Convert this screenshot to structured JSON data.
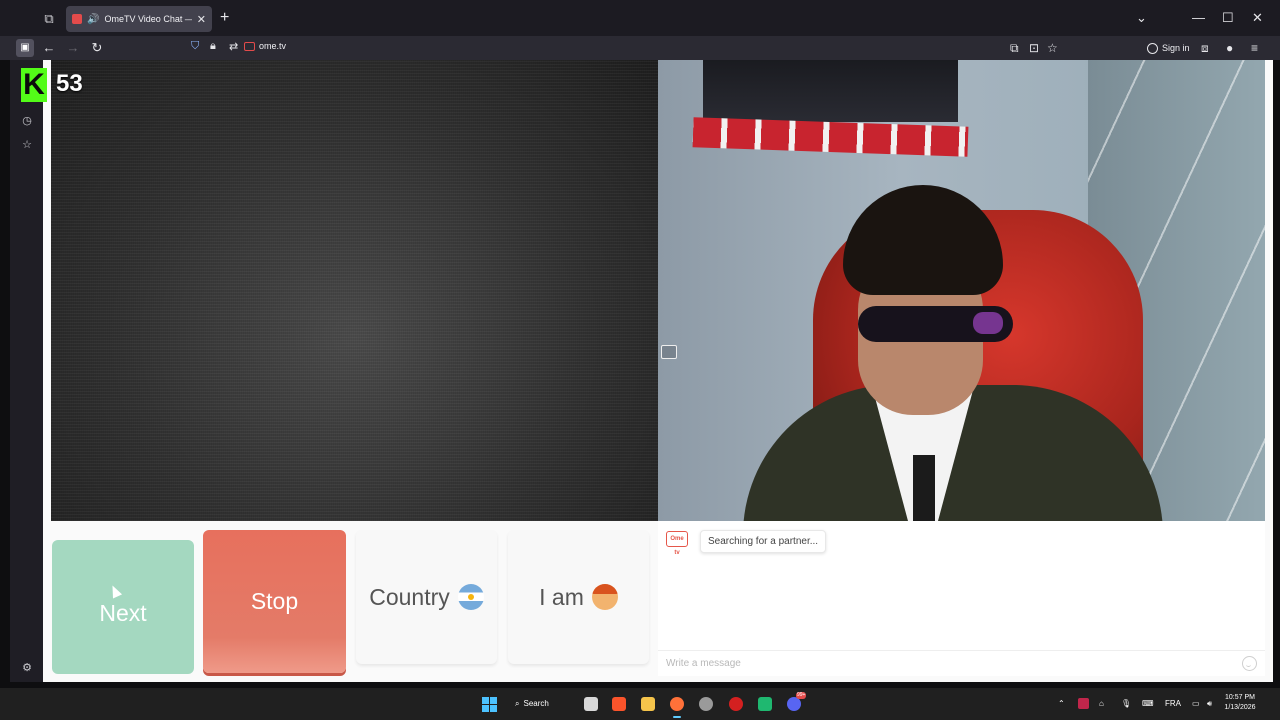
{
  "browser": {
    "tab_title": "OmeTV Video Chat — Ome",
    "tab_close": "✕",
    "new_tab": "+",
    "window_controls": {
      "list_all_tabs": "⌄",
      "minimize": "—",
      "maximize": "☐",
      "close": "✕"
    },
    "url": "ome.tv",
    "sign_in_label": "Sign in"
  },
  "stream_overlay": {
    "viewer_count": "53"
  },
  "controls": {
    "next_label": "Next",
    "stop_label": "Stop",
    "country_label": "Country",
    "country_flag": "argentina-flag-icon",
    "iam_label": "I am",
    "iam_icon": "boy-avatar-icon"
  },
  "chat": {
    "logo_text": "Ome tv",
    "status_message": "Searching for a partner...",
    "input_placeholder": "Write a message"
  },
  "taskbar": {
    "search_label": "Search",
    "language": "FRA",
    "time": "10:57 PM",
    "date": "1/13/2026",
    "discord_badge": "99+"
  },
  "colors": {
    "next_green": "#a4d8c0",
    "stop_red": "#e7705d",
    "kick_green": "#53fc18",
    "browser_dark": "#1c1b22"
  }
}
